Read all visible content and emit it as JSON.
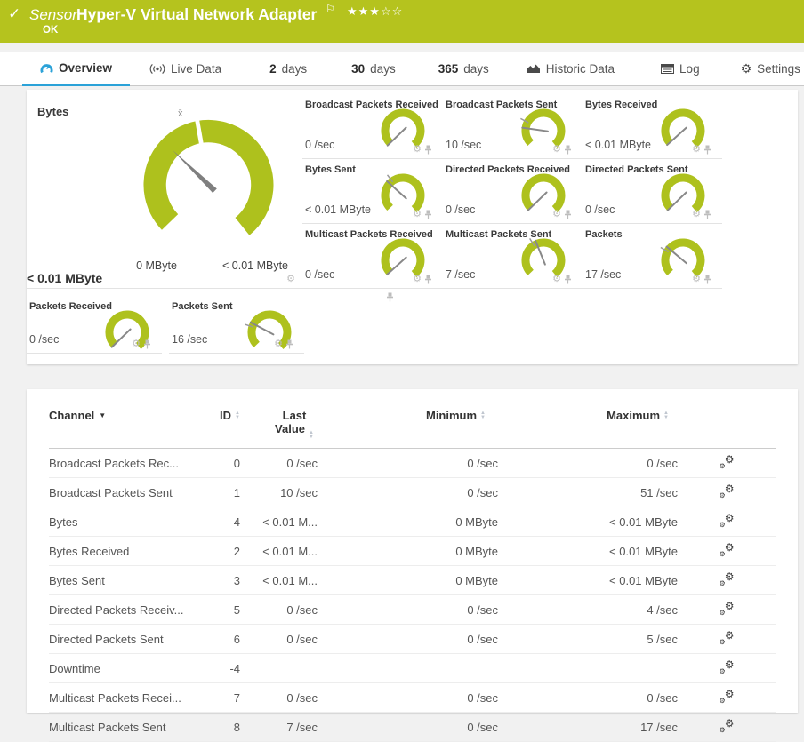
{
  "header": {
    "check": "✓",
    "kind": "Sensor",
    "title": "Hyper-V Virtual Network Adapter",
    "flag": "⚐",
    "stars_filled": "★★★",
    "stars_empty": "☆☆",
    "status": "OK"
  },
  "tabs": [
    {
      "label": "Overview",
      "active": true
    },
    {
      "label": "Live Data"
    },
    {
      "num": "2",
      "label": "days"
    },
    {
      "num": "30",
      "label": "days"
    },
    {
      "num": "365",
      "label": "days"
    },
    {
      "label": "Historic Data"
    },
    {
      "label": "Log"
    },
    {
      "label": "Settings"
    }
  ],
  "chart_data": {
    "type": "gauge-group",
    "main_gauge": {
      "title": "Bytes",
      "value": "< 0.01 MByte",
      "min_label": "0 MByte",
      "max_label": "< 0.01 MByte",
      "mean_symbol": "x̄",
      "needle_deg": 136,
      "mean_deg": 100
    },
    "small_gauges": [
      {
        "title": "Broadcast Packets Received",
        "value": "0 /sec",
        "needle_deg": 224,
        "mean_deg": null
      },
      {
        "title": "Broadcast Packets Sent",
        "value": "10 /sec",
        "needle_deg": 172,
        "mean_deg": 152
      },
      {
        "title": "Bytes Received",
        "value": "< 0.01 MByte",
        "needle_deg": 222,
        "mean_deg": null
      },
      {
        "title": "Bytes Sent",
        "value": "< 0.01 MByte",
        "needle_deg": 138,
        "mean_deg": 127
      },
      {
        "title": "Directed Packets Received",
        "value": "0 /sec",
        "needle_deg": 224,
        "mean_deg": null
      },
      {
        "title": "Directed Packets Sent",
        "value": "0 /sec",
        "needle_deg": 224,
        "mean_deg": null
      },
      {
        "title": "Multicast Packets Received",
        "value": "0 /sec",
        "needle_deg": 222,
        "mean_deg": null
      },
      {
        "title": "Multicast Packets Sent",
        "value": "7 /sec",
        "needle_deg": 112,
        "mean_deg": 122
      },
      {
        "title": "Packets",
        "value": "17 /sec",
        "needle_deg": 140,
        "mean_deg": 150
      },
      {
        "title": "Packets Received",
        "value": "0 /sec",
        "needle_deg": 224,
        "mean_deg": null
      },
      {
        "title": "Packets Sent",
        "value": "16 /sec",
        "needle_deg": 152,
        "mean_deg": 162
      }
    ]
  },
  "table": {
    "headers": {
      "channel": "Channel",
      "id": "ID",
      "last": "Last Value",
      "min": "Minimum",
      "max": "Maximum"
    },
    "rows": [
      {
        "channel": "Broadcast Packets Rec...",
        "id": "0",
        "last": "0 /sec",
        "min": "0 /sec",
        "max": "0 /sec"
      },
      {
        "channel": "Broadcast Packets Sent",
        "id": "1",
        "last": "10 /sec",
        "min": "0 /sec",
        "max": "51 /sec"
      },
      {
        "channel": "Bytes",
        "id": "4",
        "last": "< 0.01 M...",
        "min": "0 MByte",
        "max": "< 0.01 MByte"
      },
      {
        "channel": "Bytes Received",
        "id": "2",
        "last": "< 0.01 M...",
        "min": "0 MByte",
        "max": "< 0.01 MByte"
      },
      {
        "channel": "Bytes Sent",
        "id": "3",
        "last": "< 0.01 M...",
        "min": "0 MByte",
        "max": "< 0.01 MByte"
      },
      {
        "channel": "Directed Packets Receiv...",
        "id": "5",
        "last": "0 /sec",
        "min": "0 /sec",
        "max": "4 /sec"
      },
      {
        "channel": "Directed Packets Sent",
        "id": "6",
        "last": "0 /sec",
        "min": "0 /sec",
        "max": "5 /sec"
      },
      {
        "channel": "Downtime",
        "id": "-4",
        "last": "",
        "min": "",
        "max": ""
      },
      {
        "channel": "Multicast Packets Recei...",
        "id": "7",
        "last": "0 /sec",
        "min": "0 /sec",
        "max": "0 /sec"
      },
      {
        "channel": "Multicast Packets Sent",
        "id": "8",
        "last": "7 /sec",
        "min": "0 /sec",
        "max": "17 /sec"
      }
    ]
  },
  "colors": {
    "brand_green": "#b5c31e",
    "gauge_green": "#aec11d",
    "tab_active_blue": "#2ba2d8"
  }
}
